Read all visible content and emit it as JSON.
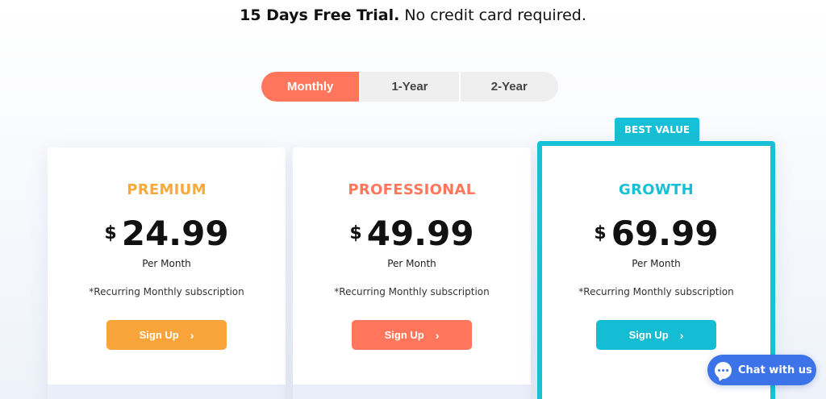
{
  "headline": {
    "bold": "15 Days Free Trial.",
    "regular": " No credit card required."
  },
  "billing_toggle": {
    "options": [
      "Monthly",
      "1-Year",
      "2-Year"
    ],
    "selected": "Monthly"
  },
  "plans": [
    {
      "name": "PREMIUM",
      "currency": "$",
      "price": "24.99",
      "period": "Per Month",
      "note": "*Recurring Monthly subscription",
      "button_label": "Sign Up",
      "accent": "#f9a43a"
    },
    {
      "name": "PROFESSIONAL",
      "currency": "$",
      "price": "49.99",
      "period": "Per Month",
      "note": "*Recurring Monthly subscription",
      "button_label": "Sign Up",
      "accent": "#ff765c"
    },
    {
      "name": "GROWTH",
      "currency": "$",
      "price": "69.99",
      "period": "Per Month",
      "note": "*Recurring Monthly subscription",
      "button_label": "Sign Up",
      "accent": "#16c0d6",
      "badge": "BEST VALUE"
    }
  ],
  "chat_widget": {
    "label": "Chat with us",
    "icon": "chat-bubble-icon",
    "color": "#3d73e8"
  },
  "icons": {
    "button_chevron": "chevron-right-icon"
  }
}
